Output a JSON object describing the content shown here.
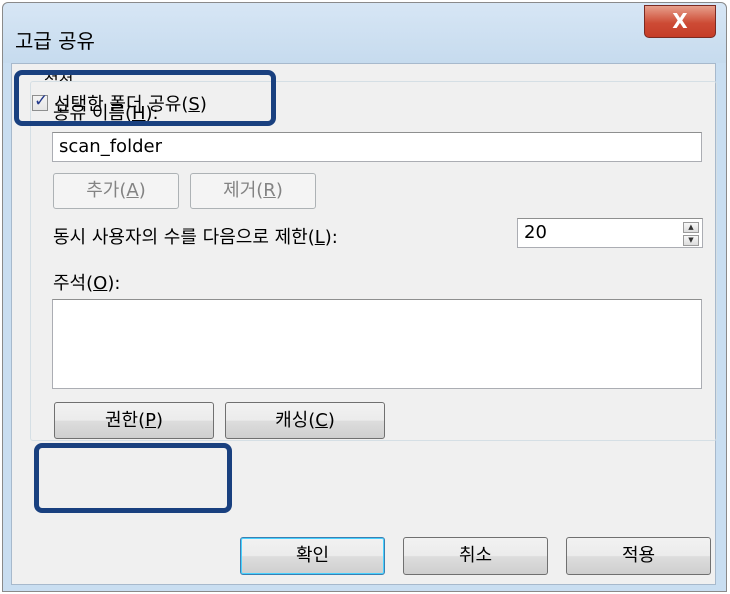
{
  "window": {
    "title": "고급 공유",
    "close_glyph": "X"
  },
  "share_checkbox": {
    "checked": true,
    "check_glyph": "✓",
    "label": "선택한 폴더 공유(S)",
    "label_pre": "선택한 폴더 공유(",
    "label_key": "S",
    "label_post": ")"
  },
  "settings": {
    "legend": "설정",
    "share_name_label_pre": "공유 이름(",
    "share_name_label_key": "H",
    "share_name_label_post": "):",
    "share_name_value": "scan_folder",
    "add_button": {
      "pre": "추가(",
      "key": "A",
      "post": ")"
    },
    "remove_button": {
      "pre": "제거(",
      "key": "R",
      "post": ")"
    },
    "limit_label_pre": "동시 사용자의 수를 다음으로 제한(",
    "limit_label_key": "L",
    "limit_label_post": "):",
    "limit_value": "20",
    "spin_up_glyph": "▲",
    "spin_down_glyph": "▼",
    "comment_label_pre": "주석(",
    "comment_label_key": "O",
    "comment_label_post": "):",
    "comment_value": "",
    "permissions_button": {
      "pre": "권한(",
      "key": "P",
      "post": ")"
    },
    "caching_button": {
      "pre": "캐싱(",
      "key": "C",
      "post": ")"
    }
  },
  "footer": {
    "ok_label": "확인",
    "cancel_label": "취소",
    "apply_label": "적용"
  },
  "colors": {
    "highlight_border": "#19407f",
    "title_bar": "#c9def1",
    "close_button": "#cd4b35"
  }
}
